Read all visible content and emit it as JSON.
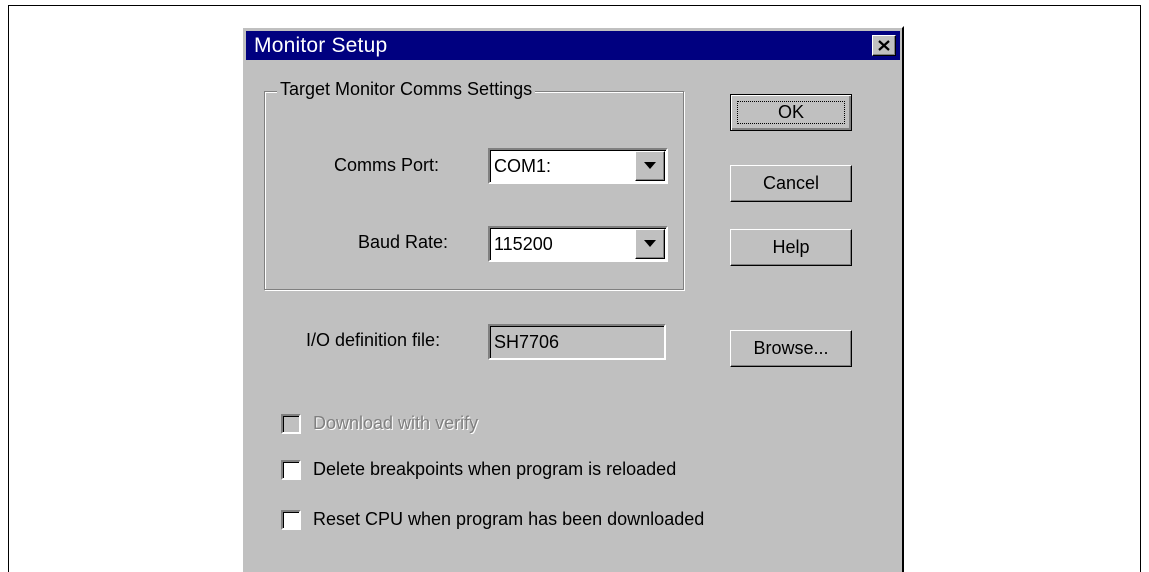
{
  "dialog": {
    "title": "Monitor Setup",
    "close_glyph": "✕"
  },
  "group": {
    "label": "Target Monitor Comms Settings",
    "comms_port": {
      "label": "Comms Port:",
      "value": "COM1:"
    },
    "baud_rate": {
      "label": "Baud Rate:",
      "value": "115200"
    }
  },
  "io_definition": {
    "label": "I/O definition file:",
    "value": "SH7706"
  },
  "buttons": {
    "ok": "OK",
    "cancel": "Cancel",
    "help": "Help",
    "browse": "Browse..."
  },
  "checkboxes": [
    {
      "label": "Download with verify",
      "checked": false,
      "enabled": false
    },
    {
      "label": "Delete breakpoints when program is reloaded",
      "checked": false,
      "enabled": true
    },
    {
      "label": "Reset CPU when program has been downloaded",
      "checked": false,
      "enabled": true
    }
  ],
  "colors": {
    "titlebar": "#000080",
    "face": "#c0c0c0",
    "disabled_text": "#808080"
  }
}
